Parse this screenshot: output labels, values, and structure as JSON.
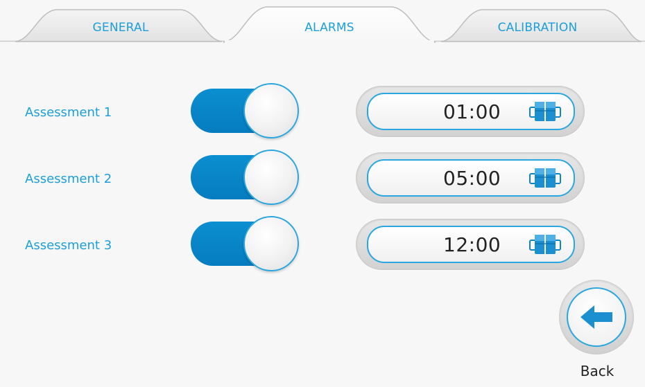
{
  "tabs": [
    {
      "label": "GENERAL",
      "active": false
    },
    {
      "label": "ALARMS",
      "active": true
    },
    {
      "label": "CALIBRATION",
      "active": false
    }
  ],
  "alarms": [
    {
      "label": "Assessment  1",
      "enabled": true,
      "time": "01:00",
      "icon": "keypad-icon"
    },
    {
      "label": "Assessment  2",
      "enabled": true,
      "time": "05:00",
      "icon": "keypad-icon"
    },
    {
      "label": "Assessment  3",
      "enabled": true,
      "time": "12:00",
      "icon": "keypad-icon"
    }
  ],
  "back": {
    "label": "Back",
    "icon": "arrow-left-icon"
  },
  "colors": {
    "accent": "#1c9fd8",
    "toggle_on": "#0b8fd0",
    "background": "#f7f7f7"
  }
}
